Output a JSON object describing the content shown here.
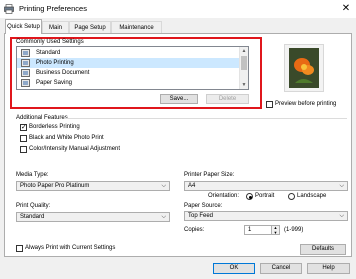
{
  "window": {
    "title": "Printing Preferences",
    "close_glyph": "✕"
  },
  "tabs": [
    {
      "label": "Quick Setup",
      "active": true
    },
    {
      "label": "Main",
      "active": false
    },
    {
      "label": "Page Setup",
      "active": false
    },
    {
      "label": "Maintenance",
      "active": false
    }
  ],
  "common_settings": {
    "label": "Commonly Used Settings",
    "items": [
      "Standard",
      "Photo Printing",
      "Business Document",
      "Paper Saving"
    ],
    "selected": "Photo Printing",
    "save_label": "Save...",
    "delete_label": "Delete"
  },
  "preview": {
    "checkbox_label": "Preview before printing",
    "checked": false
  },
  "additional_features": {
    "label": "Additional Features",
    "items": [
      {
        "label": "Borderless Printing",
        "checked": true
      },
      {
        "label": "Black and White Photo Print",
        "checked": false
      },
      {
        "label": "Color/Intensity Manual Adjustment",
        "checked": false
      }
    ]
  },
  "media_type": {
    "label": "Media Type:",
    "value": "Photo Paper Pro Platinum"
  },
  "paper_size": {
    "label": "Printer Paper Size:",
    "value": "A4"
  },
  "orientation": {
    "label": "Orientation:",
    "portrait_label": "Portrait",
    "landscape_label": "Landscape",
    "selected": "Portrait"
  },
  "print_quality": {
    "label": "Print Quality:",
    "value": "Standard"
  },
  "paper_source": {
    "label": "Paper Source:",
    "value": "Top Feed"
  },
  "copies": {
    "label": "Copies:",
    "value": "1",
    "range": "(1-999)"
  },
  "always_print": {
    "label": "Always Print with Current Settings",
    "checked": false
  },
  "defaults_label": "Defaults",
  "footer": {
    "ok_label": "OK",
    "cancel_label": "Cancel",
    "help_label": "Help"
  },
  "colors": {
    "highlight_box": "#e0161c",
    "selection": "#cce8ff",
    "accent": "#0078d7"
  }
}
